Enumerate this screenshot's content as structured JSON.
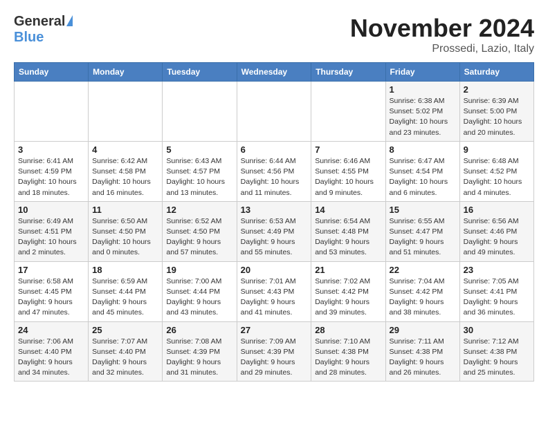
{
  "header": {
    "logo_general": "General",
    "logo_blue": "Blue",
    "month_title": "November 2024",
    "location": "Prossedi, Lazio, Italy"
  },
  "days_of_week": [
    "Sunday",
    "Monday",
    "Tuesday",
    "Wednesday",
    "Thursday",
    "Friday",
    "Saturday"
  ],
  "weeks": [
    [
      {
        "day": "",
        "info": ""
      },
      {
        "day": "",
        "info": ""
      },
      {
        "day": "",
        "info": ""
      },
      {
        "day": "",
        "info": ""
      },
      {
        "day": "",
        "info": ""
      },
      {
        "day": "1",
        "info": "Sunrise: 6:38 AM\nSunset: 5:02 PM\nDaylight: 10 hours and 23 minutes."
      },
      {
        "day": "2",
        "info": "Sunrise: 6:39 AM\nSunset: 5:00 PM\nDaylight: 10 hours and 20 minutes."
      }
    ],
    [
      {
        "day": "3",
        "info": "Sunrise: 6:41 AM\nSunset: 4:59 PM\nDaylight: 10 hours and 18 minutes."
      },
      {
        "day": "4",
        "info": "Sunrise: 6:42 AM\nSunset: 4:58 PM\nDaylight: 10 hours and 16 minutes."
      },
      {
        "day": "5",
        "info": "Sunrise: 6:43 AM\nSunset: 4:57 PM\nDaylight: 10 hours and 13 minutes."
      },
      {
        "day": "6",
        "info": "Sunrise: 6:44 AM\nSunset: 4:56 PM\nDaylight: 10 hours and 11 minutes."
      },
      {
        "day": "7",
        "info": "Sunrise: 6:46 AM\nSunset: 4:55 PM\nDaylight: 10 hours and 9 minutes."
      },
      {
        "day": "8",
        "info": "Sunrise: 6:47 AM\nSunset: 4:54 PM\nDaylight: 10 hours and 6 minutes."
      },
      {
        "day": "9",
        "info": "Sunrise: 6:48 AM\nSunset: 4:52 PM\nDaylight: 10 hours and 4 minutes."
      }
    ],
    [
      {
        "day": "10",
        "info": "Sunrise: 6:49 AM\nSunset: 4:51 PM\nDaylight: 10 hours and 2 minutes."
      },
      {
        "day": "11",
        "info": "Sunrise: 6:50 AM\nSunset: 4:50 PM\nDaylight: 10 hours and 0 minutes."
      },
      {
        "day": "12",
        "info": "Sunrise: 6:52 AM\nSunset: 4:50 PM\nDaylight: 9 hours and 57 minutes."
      },
      {
        "day": "13",
        "info": "Sunrise: 6:53 AM\nSunset: 4:49 PM\nDaylight: 9 hours and 55 minutes."
      },
      {
        "day": "14",
        "info": "Sunrise: 6:54 AM\nSunset: 4:48 PM\nDaylight: 9 hours and 53 minutes."
      },
      {
        "day": "15",
        "info": "Sunrise: 6:55 AM\nSunset: 4:47 PM\nDaylight: 9 hours and 51 minutes."
      },
      {
        "day": "16",
        "info": "Sunrise: 6:56 AM\nSunset: 4:46 PM\nDaylight: 9 hours and 49 minutes."
      }
    ],
    [
      {
        "day": "17",
        "info": "Sunrise: 6:58 AM\nSunset: 4:45 PM\nDaylight: 9 hours and 47 minutes."
      },
      {
        "day": "18",
        "info": "Sunrise: 6:59 AM\nSunset: 4:44 PM\nDaylight: 9 hours and 45 minutes."
      },
      {
        "day": "19",
        "info": "Sunrise: 7:00 AM\nSunset: 4:44 PM\nDaylight: 9 hours and 43 minutes."
      },
      {
        "day": "20",
        "info": "Sunrise: 7:01 AM\nSunset: 4:43 PM\nDaylight: 9 hours and 41 minutes."
      },
      {
        "day": "21",
        "info": "Sunrise: 7:02 AM\nSunset: 4:42 PM\nDaylight: 9 hours and 39 minutes."
      },
      {
        "day": "22",
        "info": "Sunrise: 7:04 AM\nSunset: 4:42 PM\nDaylight: 9 hours and 38 minutes."
      },
      {
        "day": "23",
        "info": "Sunrise: 7:05 AM\nSunset: 4:41 PM\nDaylight: 9 hours and 36 minutes."
      }
    ],
    [
      {
        "day": "24",
        "info": "Sunrise: 7:06 AM\nSunset: 4:40 PM\nDaylight: 9 hours and 34 minutes."
      },
      {
        "day": "25",
        "info": "Sunrise: 7:07 AM\nSunset: 4:40 PM\nDaylight: 9 hours and 32 minutes."
      },
      {
        "day": "26",
        "info": "Sunrise: 7:08 AM\nSunset: 4:39 PM\nDaylight: 9 hours and 31 minutes."
      },
      {
        "day": "27",
        "info": "Sunrise: 7:09 AM\nSunset: 4:39 PM\nDaylight: 9 hours and 29 minutes."
      },
      {
        "day": "28",
        "info": "Sunrise: 7:10 AM\nSunset: 4:38 PM\nDaylight: 9 hours and 28 minutes."
      },
      {
        "day": "29",
        "info": "Sunrise: 7:11 AM\nSunset: 4:38 PM\nDaylight: 9 hours and 26 minutes."
      },
      {
        "day": "30",
        "info": "Sunrise: 7:12 AM\nSunset: 4:38 PM\nDaylight: 9 hours and 25 minutes."
      }
    ]
  ]
}
